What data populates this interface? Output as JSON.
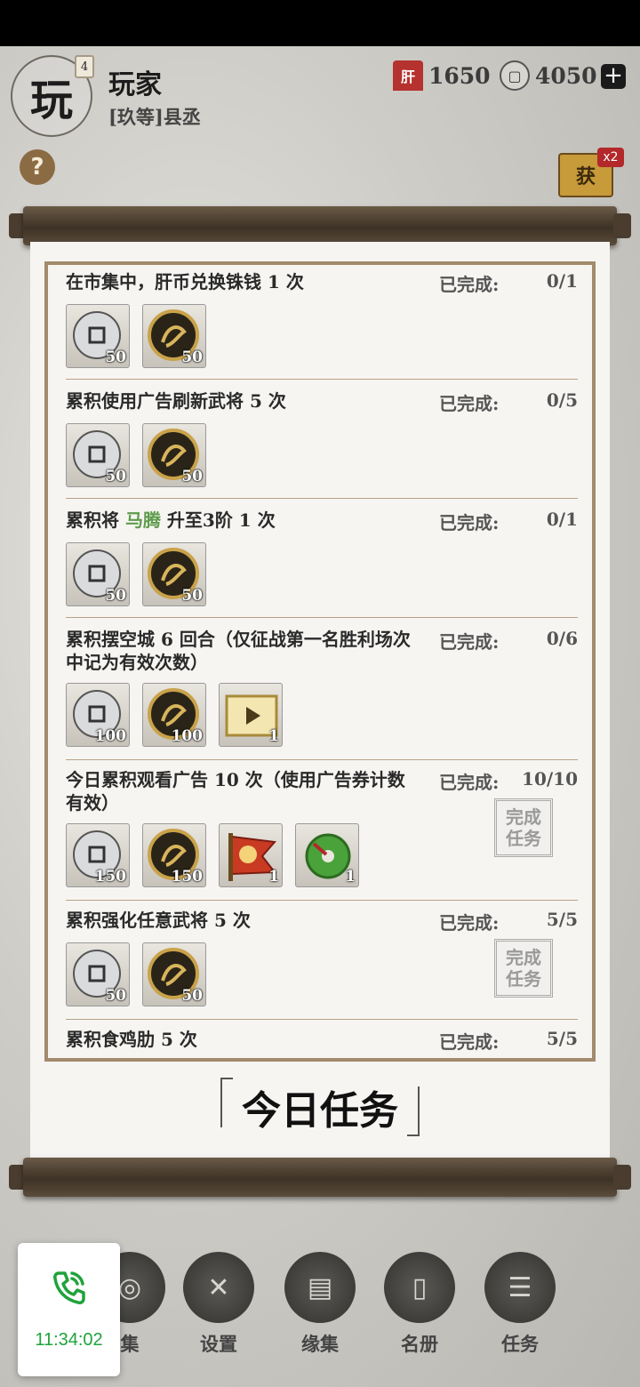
{
  "header": {
    "avatar_char": "玩",
    "avatar_level": "4",
    "player_name": "玩家",
    "player_title": "[玖等]县丞",
    "currency_liver_icon": "肝",
    "currency_liver": "1650",
    "currency_coin": "4050",
    "plus_label": "+",
    "help_label": "?",
    "scroll_icon_label": "获",
    "scroll_badge": "x2"
  },
  "colors": {
    "highlight": "#5e9b4c",
    "accent": "#a28a6c"
  },
  "tasks": [
    {
      "title": "在市集中，肝币兑换铢钱 1 次",
      "label": "已完成:",
      "progress": "0/1",
      "rewards": [
        {
          "icon": "copper-coin-icon",
          "qty": "50"
        },
        {
          "icon": "gold-coin-icon",
          "qty": "50"
        }
      ]
    },
    {
      "title": "累积使用广告刷新武将 5 次",
      "label": "已完成:",
      "progress": "0/5",
      "rewards": [
        {
          "icon": "copper-coin-icon",
          "qty": "50"
        },
        {
          "icon": "gold-coin-icon",
          "qty": "50"
        }
      ]
    },
    {
      "title_pre": "累积将 ",
      "title_hl": "马腾",
      "title_post": " 升至3阶 1 次",
      "label": "已完成:",
      "progress": "0/1",
      "rewards": [
        {
          "icon": "copper-coin-icon",
          "qty": "50"
        },
        {
          "icon": "gold-coin-icon",
          "qty": "50"
        }
      ]
    },
    {
      "title": "累积摆空城 6 回合（仅征战第一名胜利场次中记为有效次数）",
      "label": "已完成:",
      "progress": "0/6",
      "rewards": [
        {
          "icon": "copper-coin-icon",
          "qty": "100"
        },
        {
          "icon": "gold-coin-icon",
          "qty": "100"
        },
        {
          "icon": "ad-ticket-icon",
          "qty": "1"
        }
      ]
    },
    {
      "title": "今日累积观看广告 10 次（使用广告券计数有效）",
      "label": "已完成:",
      "progress": "10/10",
      "stamp": "完成任务",
      "rewards": [
        {
          "icon": "copper-coin-icon",
          "qty": "150"
        },
        {
          "icon": "gold-coin-icon",
          "qty": "150"
        },
        {
          "icon": "command-flag-icon",
          "qty": "1"
        },
        {
          "icon": "jade-disc-icon",
          "qty": "1"
        }
      ]
    },
    {
      "title": "累积强化任意武将 5 次",
      "label": "已完成:",
      "progress": "5/5",
      "stamp": "完成任务",
      "rewards": [
        {
          "icon": "copper-coin-icon",
          "qty": "50"
        },
        {
          "icon": "gold-coin-icon",
          "qty": "50"
        }
      ]
    },
    {
      "title": "累积食鸡肋 5 次",
      "label": "已完成:",
      "progress": "5/5"
    }
  ],
  "banner": "今日任务",
  "nav": [
    {
      "label": "集",
      "icon": "coin-collection-icon"
    },
    {
      "label": "设置",
      "icon": "settings-icon"
    },
    {
      "label": "缘集",
      "icon": "book-icon"
    },
    {
      "label": "名册",
      "icon": "roster-icon"
    },
    {
      "label": "任务",
      "icon": "scroll-task-icon"
    }
  ],
  "call": {
    "time": "11:34:02",
    "icon": "phone-call-icon"
  }
}
